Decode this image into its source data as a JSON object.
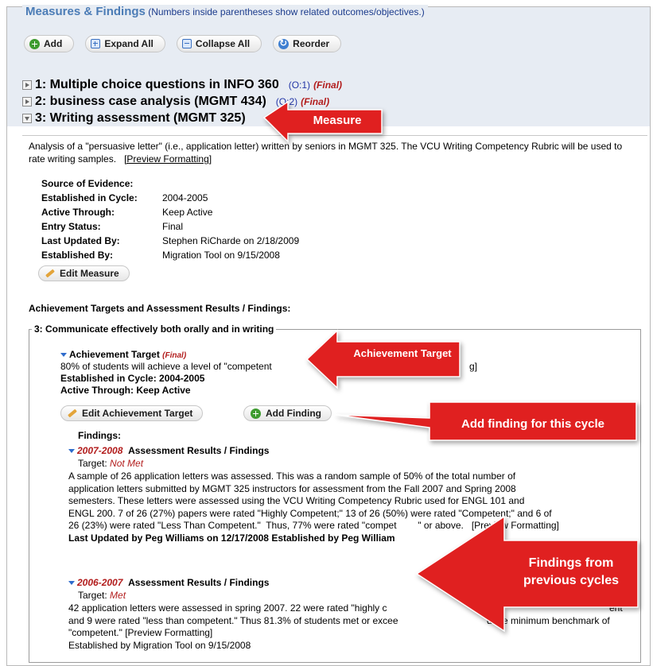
{
  "section": {
    "title": "Measures & Findings",
    "note": "(Numbers inside parentheses show related outcomes/objectives.)"
  },
  "toolbar": {
    "add": "Add",
    "expand_all": "Expand All",
    "collapse_all": "Collapse All",
    "reorder": "Reorder"
  },
  "measures": [
    {
      "title": "1: Multiple choice questions in INFO 360",
      "link": "(O:1)",
      "status": "(Final)"
    },
    {
      "title": "2: business case analysis (MGMT 434)",
      "link": "(O:2)",
      "status": "(Final)"
    },
    {
      "title": "3: Writing assessment (MGMT 325)"
    }
  ],
  "measure3": {
    "description": "Analysis of a \"persuasive letter\" (i.e., application letter) written by seniors in MGMT 325. The VCU Writing Competency Rubric will be used to rate writing samples.",
    "preview": "[Preview Formatting]",
    "details": [
      {
        "key": "Source of Evidence:",
        "value": ""
      },
      {
        "key": "Established in Cycle:",
        "value": "2004-2005"
      },
      {
        "key": "Active Through:",
        "value": "Keep Active"
      },
      {
        "key": "Entry Status:",
        "value": "Final"
      },
      {
        "key": "Last Updated By:",
        "value": "Stephen RiCharde on 2/18/2009"
      },
      {
        "key": "Established By:",
        "value": "Migration Tool on 9/15/2008"
      }
    ],
    "edit_measure": "Edit Measure",
    "targets_heading": "Achievement Targets and Assessment Results / Findings:",
    "outcome_legend": "3: Communicate effectively both orally and in writing",
    "target": {
      "label": "Achievement Target",
      "status": "(Final)",
      "text": "80% of students will achieve a level of \"competent",
      "text_tail": "g]",
      "cycle": "Established in Cycle: 2004-2005",
      "active": "Active Through: Keep Active",
      "edit_button": "Edit Achievement Target",
      "add_finding_button": "Add Finding"
    },
    "findings_label": "Findings:",
    "findings": [
      {
        "year": "2007-2008",
        "heading": "Assessment Results / Findings",
        "target_label": "Target:",
        "target_status": "Not Met",
        "lines": [
          "A sample of 26 application letters was assessed.  This was a random sample of 50% of the total number of",
          "application letters submitted by MGMT 325 instructors for assessment from the Fall 2007 and Spring 2008",
          "semesters. These letters were assessed using the VCU Writing Competency Rubric used for ENGL 101 and",
          "ENGL 200. 7 of 26 (27%) papers were rated \"Highly Competent;\" 13 of 26 (50%) were rated \"Competent;\" and 6 of",
          "26 (23%) were rated \"Less Than Competent.\"  Thus, 77% were rated \"compet        \" or above.   [Preview Formatting]"
        ],
        "footer": "Last Updated by Peg Williams on 12/17/2008 Established by Peg William"
      },
      {
        "year": "2006-2007",
        "heading": "Assessment Results / Findings",
        "target_label": "Target:",
        "target_status": "Met",
        "lines": [
          "42 application letters were assessed in spring 2007. 22 were rated \"highly c",
          "and 9 were rated \"less than competent.\" Thus 81.3% of students met or excee",
          "\"competent.\"  [Preview Formatting]"
        ],
        "lines_tail": [
          "ent\"",
          "d the minimum benchmark of",
          ""
        ],
        "footer": "Established by Migration Tool on 9/15/2008"
      }
    ]
  },
  "callouts": {
    "measure": "Measure",
    "achievement_target": "Achievement Target",
    "add_finding": "Add finding for this cycle",
    "findings_prev": "Findings from previous cycles"
  },
  "colors": {
    "title_blue": "#4b7cb6",
    "callout_red": "#e02020",
    "final_red": "#b21c1c",
    "band": "#e7ecf3"
  }
}
